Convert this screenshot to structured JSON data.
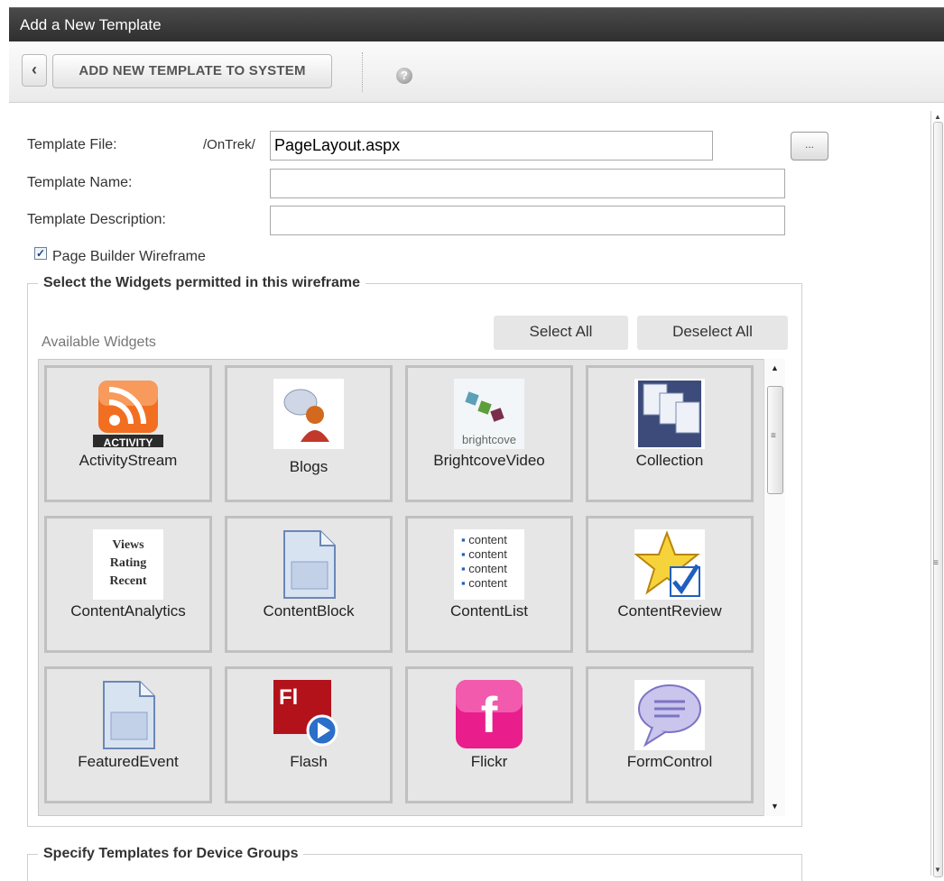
{
  "window": {
    "title": "Add a New Template"
  },
  "toolbar": {
    "back_label": "‹",
    "add_label": "ADD NEW TEMPLATE TO SYSTEM",
    "help_label": "?"
  },
  "form": {
    "template_file_label": "Template File:",
    "template_file_prefix": "/OnTrek/",
    "template_file_value": "PageLayout.aspx",
    "browse_label": "...",
    "template_name_label": "Template Name:",
    "template_name_value": "",
    "template_description_label": "Template Description:",
    "template_description_value": "",
    "wireframe_label": "Page Builder Wireframe",
    "wireframe_checked": true
  },
  "widgets_section": {
    "legend": "Select the Widgets permitted in this wireframe",
    "select_all": "Select All",
    "deselect_all": "Deselect All",
    "available_label": "Available Widgets",
    "items": [
      {
        "name": "ActivityStream",
        "icon": "rss-activity-icon",
        "badge": "ACTIVITY"
      },
      {
        "name": "Blogs",
        "icon": "blogs-icon"
      },
      {
        "name": "BrightcoveVideo",
        "icon": "brightcove-icon",
        "caption": "brightcove"
      },
      {
        "name": "Collection",
        "icon": "collection-icon"
      },
      {
        "name": "ContentAnalytics",
        "icon": "content-analytics-icon",
        "lines": [
          "Views",
          "Rating",
          "Recent"
        ]
      },
      {
        "name": "ContentBlock",
        "icon": "content-block-icon"
      },
      {
        "name": "ContentList",
        "icon": "content-list-icon",
        "lines": [
          "content",
          "content",
          "content",
          "content"
        ]
      },
      {
        "name": "ContentReview",
        "icon": "star-check-icon"
      },
      {
        "name": "FeaturedEvent",
        "icon": "featured-event-icon"
      },
      {
        "name": "Flash",
        "icon": "flash-icon",
        "badge": "Fl"
      },
      {
        "name": "Flickr",
        "icon": "flickr-icon",
        "badge": "f"
      },
      {
        "name": "FormControl",
        "icon": "speech-bubble-icon"
      }
    ]
  },
  "device_section": {
    "legend": "Specify Templates for Device Groups"
  },
  "colors": {
    "titlebar": "#3a3a3a",
    "rss": "#f26f21",
    "flash": "#b3121b",
    "flickr": "#e91e8c",
    "check": "#1f5fbf"
  }
}
